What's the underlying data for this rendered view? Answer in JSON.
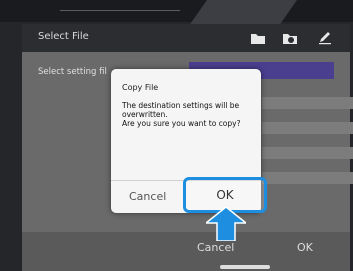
{
  "header": {
    "title": "Select File",
    "icons": [
      "folder-icon",
      "folder-sync-icon",
      "edit-icon"
    ]
  },
  "panel": {
    "label": "Select setting fil"
  },
  "dialog": {
    "title": "Copy File",
    "message": "The destination settings will be overwritten.\nAre you sure you want to copy?",
    "cancel": "Cancel",
    "ok": "OK"
  },
  "footer": {
    "cancel": "Cancel",
    "ok": "OK"
  },
  "colors": {
    "accent": "#1e8fe0",
    "selection": "#4a3f8f"
  }
}
